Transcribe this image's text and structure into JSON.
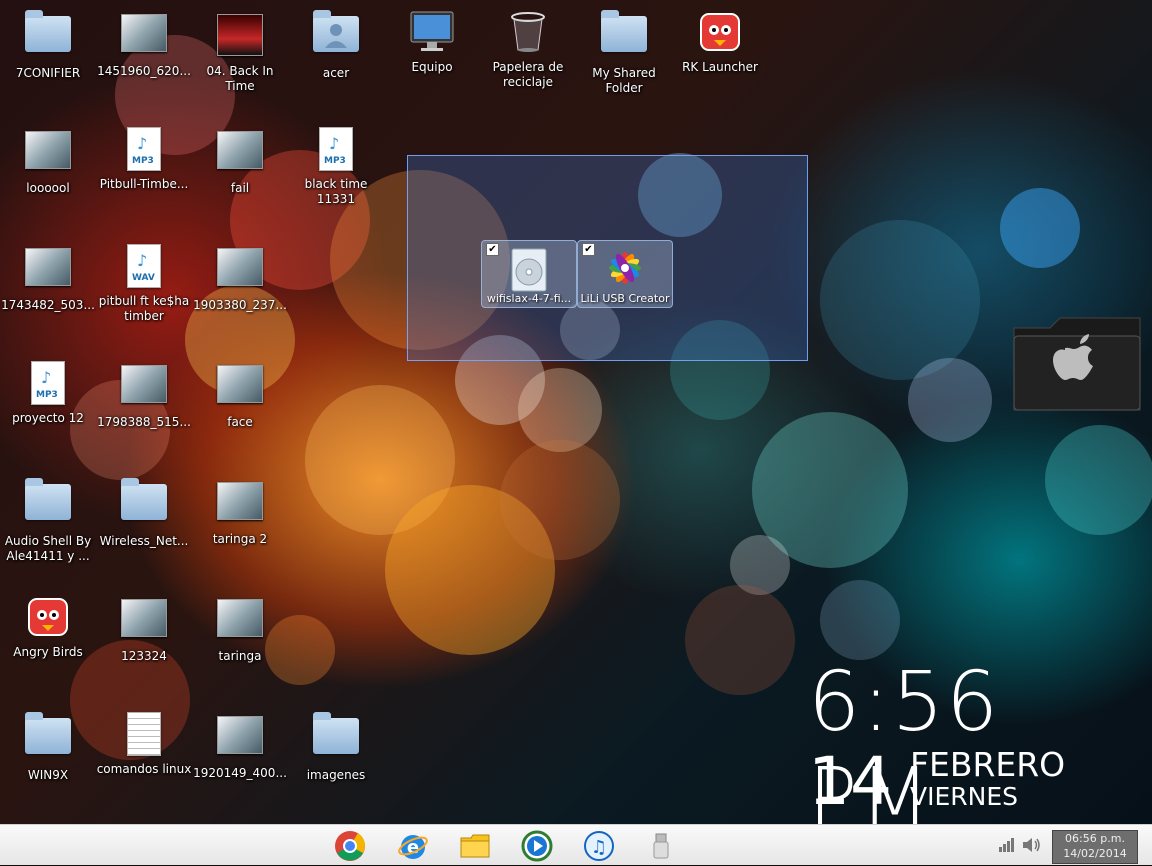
{
  "desktop_icons": [
    {
      "label": "7CONIFIER",
      "type": "folder"
    },
    {
      "label": "1451960_620...",
      "type": "image"
    },
    {
      "label": "04. Back In Time",
      "type": "video"
    },
    {
      "label": "acer",
      "type": "folder-user"
    },
    {
      "label": "Equipo",
      "type": "computer"
    },
    {
      "label": "Papelera de reciclaje",
      "type": "recycle-bin"
    },
    {
      "label": "My Shared Folder",
      "type": "folder"
    },
    {
      "label": "RK Launcher",
      "type": "app"
    },
    {
      "label": "loooool",
      "type": "image"
    },
    {
      "label": "Pitbull-Timbe...",
      "type": "mp3"
    },
    {
      "label": "fail",
      "type": "image"
    },
    {
      "label": "black time 11331",
      "type": "mp3"
    },
    {
      "label": "1743482_503...",
      "type": "image"
    },
    {
      "label": "pitbull ft ke$ha timber",
      "type": "wav"
    },
    {
      "label": "1903380_237...",
      "type": "image"
    },
    {
      "label": "proyecto 12",
      "type": "mp3"
    },
    {
      "label": "1798388_515...",
      "type": "image"
    },
    {
      "label": "face",
      "type": "image"
    },
    {
      "label": "Audio Shell By Ale41411 y ...",
      "type": "folder"
    },
    {
      "label": "Wireless_Net...",
      "type": "folder"
    },
    {
      "label": "taringa 2",
      "type": "image"
    },
    {
      "label": "Angry Birds",
      "type": "app"
    },
    {
      "label": "123324",
      "type": "image"
    },
    {
      "label": "taringa",
      "type": "image"
    },
    {
      "label": "WIN9X",
      "type": "folder"
    },
    {
      "label": "comandos linux",
      "type": "text"
    },
    {
      "label": "1920149_400...",
      "type": "image"
    },
    {
      "label": "imagenes",
      "type": "folder"
    }
  ],
  "selected_icons": [
    {
      "label": "wifislax-4-7-fi...",
      "type": "disc-image"
    },
    {
      "label": "LiLi USB Creator",
      "type": "app"
    }
  ],
  "clock_widget": {
    "time": "6:56 PM",
    "day": "14",
    "month": "FEBRERO",
    "weekday": "VIERNES"
  },
  "taskbar": {
    "apps": [
      {
        "name": "Google Chrome",
        "icon": "chrome-icon"
      },
      {
        "name": "Internet Explorer",
        "icon": "ie-icon"
      },
      {
        "name": "Explorador de archivos",
        "icon": "folder-icon"
      },
      {
        "name": "Windows Media Player",
        "icon": "media-player-icon"
      },
      {
        "name": "iTunes",
        "icon": "itunes-icon"
      },
      {
        "name": "USB",
        "icon": "usb-icon"
      }
    ],
    "tray": {
      "time": "06:56 p.m.",
      "date": "14/02/2014"
    }
  },
  "colors": {
    "selection": "#3c6ebe",
    "taskbar": "#efefef",
    "folder": "#a9c6e3"
  }
}
